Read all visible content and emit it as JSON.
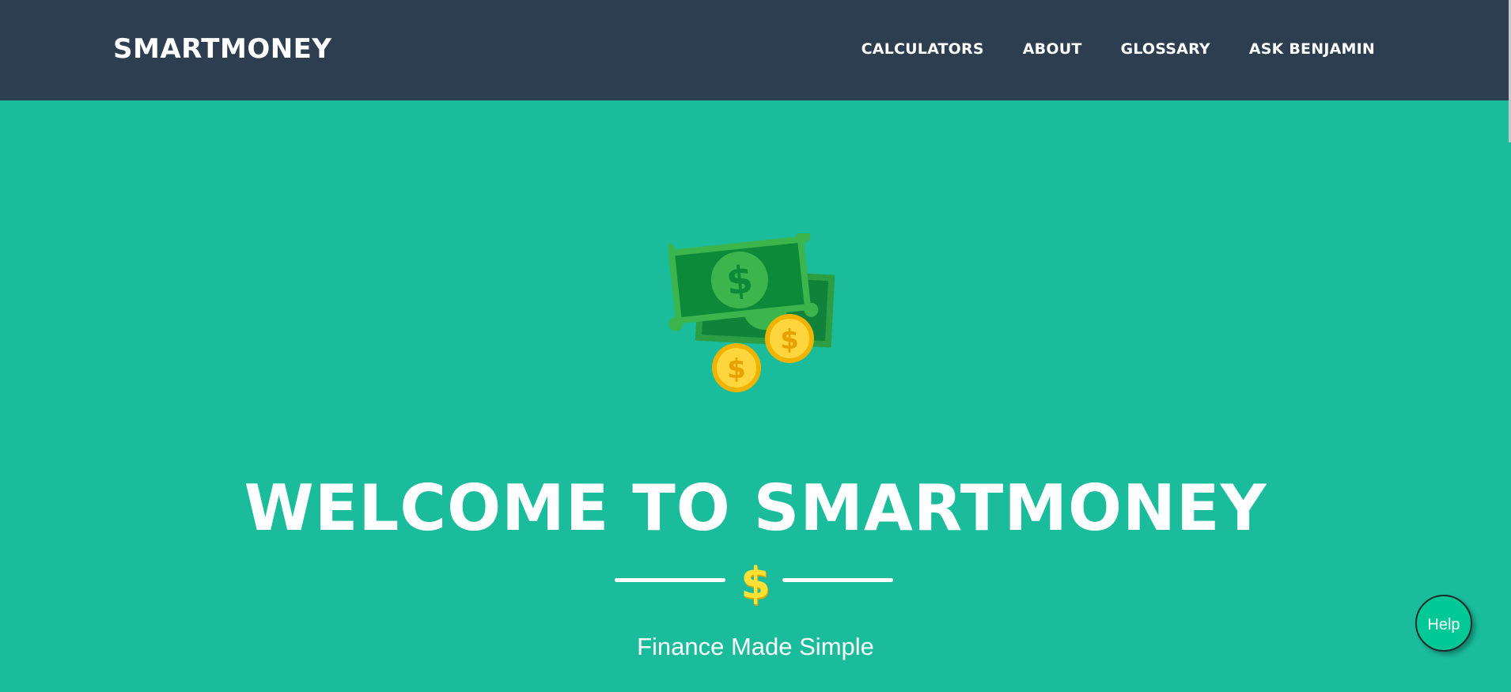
{
  "navbar": {
    "brand": "SMARTMONEY",
    "links": [
      {
        "label": "CALCULATORS"
      },
      {
        "label": "ABOUT"
      },
      {
        "label": "GLOSSARY"
      },
      {
        "label": "ASK BENJAMIN"
      }
    ]
  },
  "hero": {
    "image_icon": "money-bills-coins-icon",
    "title": "WELCOME TO SMARTMONEY",
    "divider_symbol": "$",
    "subtitle": "Finance Made Simple"
  },
  "help": {
    "label": "Help"
  },
  "colors": {
    "navbar_bg": "#2c3e50",
    "hero_bg": "#1abc9c",
    "accent_gold": "#ffe135",
    "help_button": "#00c896"
  }
}
